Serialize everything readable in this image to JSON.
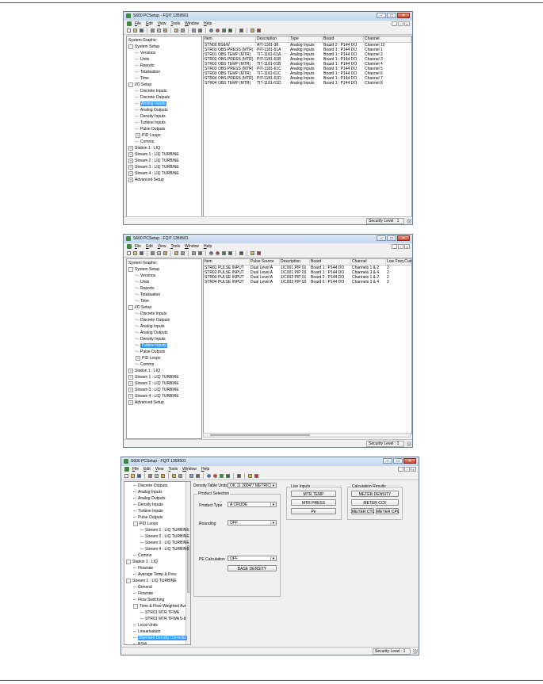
{
  "windows": [
    {
      "title": "S600 PCSetup - FQIT 1359501",
      "menu": [
        "File",
        "Edit",
        "View",
        "Tools",
        "Window",
        "Help"
      ],
      "tree": [
        {
          "label": "System Graphic",
          "level": 0,
          "exp": ""
        },
        {
          "label": "System Setup",
          "level": 0,
          "exp": "-"
        },
        {
          "label": "Versions",
          "level": 1,
          "exp": ""
        },
        {
          "label": "Units",
          "level": 1,
          "exp": ""
        },
        {
          "label": "Reports",
          "level": 1,
          "exp": ""
        },
        {
          "label": "Totalisation",
          "level": 1,
          "exp": ""
        },
        {
          "label": "Time",
          "level": 1,
          "exp": ""
        },
        {
          "label": "I/O Setup",
          "level": 0,
          "exp": "-"
        },
        {
          "label": "Discrete Inputs",
          "level": 1,
          "exp": ""
        },
        {
          "label": "Discrete Outputs",
          "level": 1,
          "exp": ""
        },
        {
          "label": "Analog Inputs",
          "level": 1,
          "exp": "",
          "selected": true
        },
        {
          "label": "Analog Outputs",
          "level": 1,
          "exp": ""
        },
        {
          "label": "Density Inputs",
          "level": 1,
          "exp": ""
        },
        {
          "label": "Turbine Inputs",
          "level": 1,
          "exp": ""
        },
        {
          "label": "Pulse Outputs",
          "level": 1,
          "exp": ""
        },
        {
          "label": "PID Loops",
          "level": 1,
          "exp": "+"
        },
        {
          "label": "Comms",
          "level": 1,
          "exp": ""
        },
        {
          "label": "Station 1 : LIQ",
          "level": 0,
          "exp": "+"
        },
        {
          "label": "Stream 1 : LIQ TURBINE",
          "level": 0,
          "exp": "+"
        },
        {
          "label": "Stream 2 : LIQ TURBINE",
          "level": 0,
          "exp": "+"
        },
        {
          "label": "Stream 3 : LIQ TURBINE",
          "level": 0,
          "exp": "+"
        },
        {
          "label": "Stream 4 : LIQ TURBINE",
          "level": 0,
          "exp": "+"
        },
        {
          "label": "Advanced Setup",
          "level": 0,
          "exp": "+"
        }
      ],
      "columns": [
        "Item",
        "Description",
        "Type",
        "Board",
        "Channel"
      ],
      "rows": [
        [
          "STN00 BS&W",
          "AIT-1181-38",
          "Analog Inputs",
          "Board 2 : P144 DO",
          "Channel 12"
        ],
        [
          "STR01 OBS PRESS (MTR)",
          "PIT-1181-61A",
          "Analog Inputs",
          "Board 1 : P144 DO",
          "Channel 1"
        ],
        [
          "STR01 OBS TEMP (MTR)",
          "TIT-1181-61A",
          "Analog Inputs",
          "Board 1 : P144 DO",
          "Channel 2"
        ],
        [
          "STR02 OBS PRESS (MTR)",
          "PIT-1181-61B",
          "Analog Inputs",
          "Board 1 : P144 DO",
          "Channel 3"
        ],
        [
          "STR02 OBS TEMP (MTR)",
          "TIT-1181-61B",
          "Analog Inputs",
          "Board 1 : P144 DO",
          "Channel 4"
        ],
        [
          "STR03 OBS PRESS (MTR)",
          "PIT-1181-61C",
          "Analog Inputs",
          "Board 1 : P144 DO",
          "Channel 5"
        ],
        [
          "STR03 OBS TEMP (MTR)",
          "TIT-1181-61C",
          "Analog Inputs",
          "Board 1 : P144 DO",
          "Channel 6"
        ],
        [
          "STR04 OBS PRESS (MTR)",
          "PIT-1181-61D",
          "Analog Inputs",
          "Board 1 : P144 DO",
          "Channel 7"
        ],
        [
          "STR04 OBS TEMP (MTR)",
          "TIT-1181-61D",
          "Analog Inputs",
          "Board 1 : P144 DO",
          "Channel 8"
        ]
      ],
      "status": "Security Level : 1"
    },
    {
      "title": "S600 PCSetup - FQIT 1359501",
      "menu": [
        "File",
        "Edit",
        "View",
        "Tools",
        "Window",
        "Help"
      ],
      "tree": [
        {
          "label": "System Graphic",
          "level": 0,
          "exp": ""
        },
        {
          "label": "System Setup",
          "level": 0,
          "exp": "-"
        },
        {
          "label": "Versions",
          "level": 1,
          "exp": ""
        },
        {
          "label": "Units",
          "level": 1,
          "exp": ""
        },
        {
          "label": "Reports",
          "level": 1,
          "exp": ""
        },
        {
          "label": "Totalisation",
          "level": 1,
          "exp": ""
        },
        {
          "label": "Time",
          "level": 1,
          "exp": ""
        },
        {
          "label": "I/O Setup",
          "level": 0,
          "exp": "-"
        },
        {
          "label": "Discrete Inputs",
          "level": 1,
          "exp": ""
        },
        {
          "label": "Discrete Outputs",
          "level": 1,
          "exp": ""
        },
        {
          "label": "Analog Inputs",
          "level": 1,
          "exp": ""
        },
        {
          "label": "Analog Outputs",
          "level": 1,
          "exp": ""
        },
        {
          "label": "Density Inputs",
          "level": 1,
          "exp": ""
        },
        {
          "label": "Turbine Inputs",
          "level": 1,
          "exp": "",
          "selected": true
        },
        {
          "label": "Pulse Outputs",
          "level": 1,
          "exp": ""
        },
        {
          "label": "PID Loops",
          "level": 1,
          "exp": "+"
        },
        {
          "label": "Comms",
          "level": 1,
          "exp": ""
        },
        {
          "label": "Station 1 : LIQ",
          "level": 0,
          "exp": "+"
        },
        {
          "label": "Stream 1 : LIQ TURBINE",
          "level": 0,
          "exp": "+"
        },
        {
          "label": "Stream 2 : LIQ TURBINE",
          "level": 0,
          "exp": "+"
        },
        {
          "label": "Stream 3 : LIQ TURBINE",
          "level": 0,
          "exp": "+"
        },
        {
          "label": "Stream 4 : LIQ TURBINE",
          "level": 0,
          "exp": "+"
        },
        {
          "label": "Advanced Setup",
          "level": 0,
          "exp": "+"
        }
      ],
      "columns": [
        "Item",
        "Pulse Source",
        "Description",
        "Board",
        "Channel",
        "Low Freq Cuto"
      ],
      "rows": [
        [
          "STR01 PULSE INPUT",
          "Dual Level A",
          "1/C001 PIP 01",
          "Board 1 : P144 DO",
          "Channels 1 & 2",
          "2"
        ],
        [
          "STR02 PULSE INPUT",
          "Dual Level A",
          "1/C001 PIP 03",
          "Board 1 : P144 DO",
          "Channels 3 & 4",
          "2"
        ],
        [
          "STR03 PULSE INPUT",
          "Dual Level A",
          "1/C002 PIP 01",
          "Board 2 : P144 DO",
          "Channels 1 & 2",
          "2"
        ],
        [
          "STR04 PULSE INPUT",
          "Dual Level A",
          "1/C002 PIP 03",
          "Board 2 : P144 DO",
          "Channels 3 & 4",
          "2"
        ]
      ],
      "status": "Security Level : 1"
    },
    {
      "title": "S600 PCSetup - FQIT 1359501",
      "menu": [
        "File",
        "Edit",
        "View",
        "Tools",
        "Window",
        "Help"
      ],
      "tree": [
        {
          "label": "Discrete Outputs",
          "level": 1,
          "exp": ""
        },
        {
          "label": "Analog Inputs",
          "level": 1,
          "exp": ""
        },
        {
          "label": "Analog Outputs",
          "level": 1,
          "exp": ""
        },
        {
          "label": "Density Inputs",
          "level": 1,
          "exp": ""
        },
        {
          "label": "Turbine Inputs",
          "level": 1,
          "exp": ""
        },
        {
          "label": "Pulse Outputs",
          "level": 1,
          "exp": ""
        },
        {
          "label": "PID Loops",
          "level": 1,
          "exp": "-"
        },
        {
          "label": "Stream 1 : LIQ TURBINE",
          "level": 2,
          "exp": ""
        },
        {
          "label": "Stream 2 : LIQ TURBINE",
          "level": 2,
          "exp": ""
        },
        {
          "label": "Stream 3 : LIQ TURBINE",
          "level": 2,
          "exp": ""
        },
        {
          "label": "Stream 4 : LIQ TURBINE",
          "level": 2,
          "exp": ""
        },
        {
          "label": "Comms",
          "level": 1,
          "exp": ""
        },
        {
          "label": "Station 1 : LIQ",
          "level": 0,
          "exp": "-"
        },
        {
          "label": "Flowrate",
          "level": 1,
          "exp": ""
        },
        {
          "label": "Average Temp & Pres",
          "level": 1,
          "exp": ""
        },
        {
          "label": "Stream 1 : LIQ TURBINE",
          "level": 0,
          "exp": "-"
        },
        {
          "label": "General",
          "level": 1,
          "exp": ""
        },
        {
          "label": "Flowrate",
          "level": 1,
          "exp": ""
        },
        {
          "label": "Flow Switching",
          "level": 1,
          "exp": ""
        },
        {
          "label": "Time & Flow Weighted Avr",
          "level": 1,
          "exp": "-"
        },
        {
          "label": "STR01 MTR TFWA",
          "level": 2,
          "exp": ""
        },
        {
          "label": "STR01 MTR TFWA 5-8",
          "level": 2,
          "exp": ""
        },
        {
          "label": "Local Units",
          "level": 1,
          "exp": ""
        },
        {
          "label": "Linearisation",
          "level": 1,
          "exp": ""
        },
        {
          "label": "Standard Density Correctio",
          "level": 1,
          "exp": "",
          "selected": true
        },
        {
          "label": "BSW",
          "level": 1,
          "exp": ""
        },
        {
          "label": "Stream 2 : LIQ TURBINE",
          "level": 0,
          "exp": "+"
        },
        {
          "label": "Stream 3 : LIQ TURBINE",
          "level": 0,
          "exp": "+"
        }
      ],
      "form": {
        "density_table_units_label": "Density Table Units",
        "density_table_units_value": "OK 11 2004/7 METRIC",
        "product_selection_legend": "Product Selection",
        "product_type_label": "Product Type",
        "product_type_value": "A CRUDE",
        "rounding_label": "Rounding",
        "rounding_value": "OFF",
        "pe_calculation_label": "PE Calculation",
        "pe_calculation_value": "OFF",
        "base_density_button": "BASE DENSITY",
        "live_inputs_legend": "Live Inputs",
        "mtr_temp_button": "MTR TEMP",
        "mtr_press_button": "MTR PRESS",
        "pe_button": "Pe",
        "calculation_results_legend": "Calculation Results",
        "meter_density_button": "METER DENSITY",
        "meter_ccf_button": "METER CCF",
        "meter_ctl_button": "METER CTL",
        "meter_cpl_button": "METER CPL"
      },
      "status": "Security Level : 1"
    }
  ],
  "toolbar_icons": [
    "new-icon",
    "open-icon",
    "save-icon",
    "sep",
    "cut-icon",
    "copy-icon",
    "paste-icon",
    "sep",
    "connect-icon",
    "disconnect-icon",
    "sep",
    "compare-icon",
    "terminal-icon",
    "sep",
    "circle-icon",
    "stop-icon",
    "tree-icon",
    "arrow-icon",
    "sep",
    "print-icon",
    "sep",
    "help-icon",
    "pointer-icon"
  ]
}
